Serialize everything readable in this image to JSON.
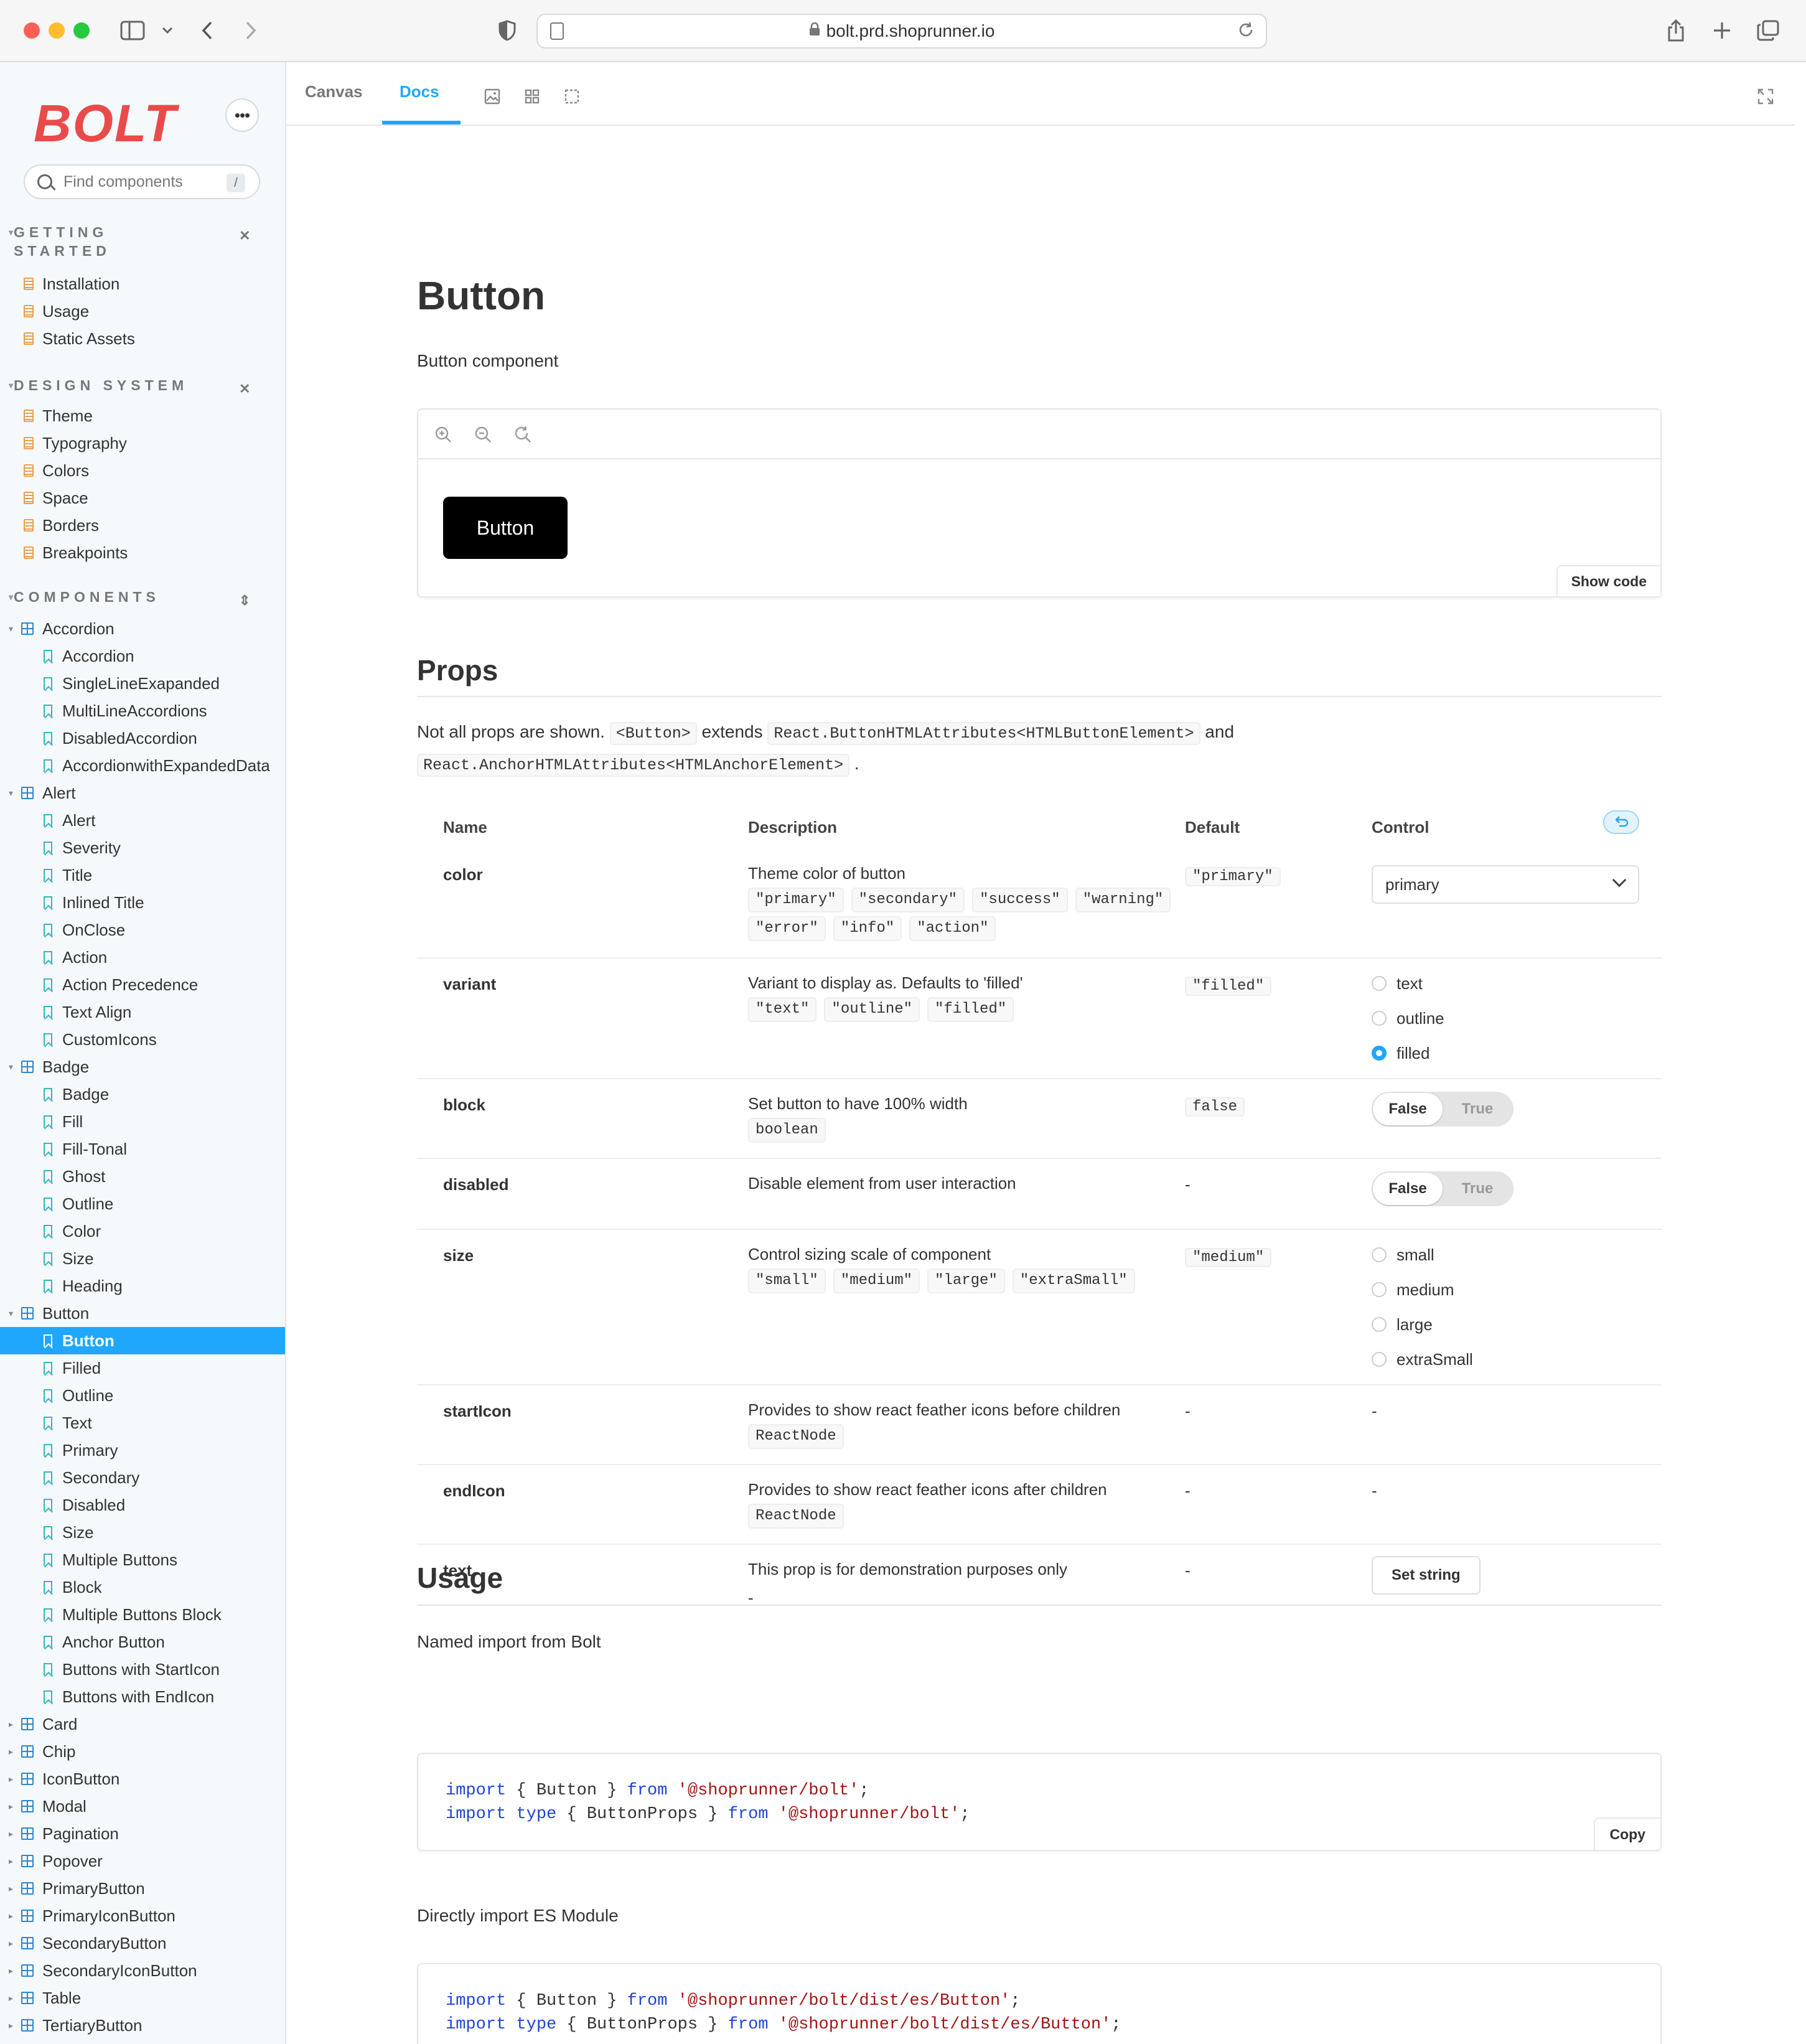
{
  "browser": {
    "url": "bolt.prd.shoprunner.io",
    "traffic_colors": [
      "#ff5f57",
      "#febc2e",
      "#28c840"
    ]
  },
  "sidebar": {
    "logo": "BOLT",
    "search_placeholder": "Find components",
    "search_shortcut": "/",
    "sections": [
      {
        "title_line1": "GETTING",
        "title_line2": "STARTED",
        "items": [
          "Installation",
          "Usage",
          "Static Assets"
        ]
      },
      {
        "title_line1": "DESIGN SYSTEM",
        "items": [
          "Theme",
          "Typography",
          "Colors",
          "Space",
          "Borders",
          "Breakpoints"
        ]
      },
      {
        "title_line1": "COMPONENTS"
      }
    ],
    "tree": [
      {
        "label": "Accordion",
        "type": "component",
        "expanded": true
      },
      {
        "label": "Accordion",
        "type": "story"
      },
      {
        "label": "SingleLineExapanded",
        "type": "story"
      },
      {
        "label": "MultiLineAccordions",
        "type": "story"
      },
      {
        "label": "DisabledAccordion",
        "type": "story"
      },
      {
        "label": "AccordionwithExpandedData",
        "type": "story"
      },
      {
        "label": "Alert",
        "type": "component",
        "expanded": true
      },
      {
        "label": "Alert",
        "type": "story"
      },
      {
        "label": "Severity",
        "type": "story"
      },
      {
        "label": "Title",
        "type": "story"
      },
      {
        "label": "Inlined Title",
        "type": "story"
      },
      {
        "label": "OnClose",
        "type": "story"
      },
      {
        "label": "Action",
        "type": "story"
      },
      {
        "label": "Action Precedence",
        "type": "story"
      },
      {
        "label": "Text Align",
        "type": "story"
      },
      {
        "label": "CustomIcons",
        "type": "story"
      },
      {
        "label": "Badge",
        "type": "component",
        "expanded": true
      },
      {
        "label": "Badge",
        "type": "story"
      },
      {
        "label": "Fill",
        "type": "story"
      },
      {
        "label": "Fill-Tonal",
        "type": "story"
      },
      {
        "label": "Ghost",
        "type": "story"
      },
      {
        "label": "Outline",
        "type": "story"
      },
      {
        "label": "Color",
        "type": "story"
      },
      {
        "label": "Size",
        "type": "story"
      },
      {
        "label": "Heading",
        "type": "story"
      },
      {
        "label": "Button",
        "type": "component",
        "expanded": true
      },
      {
        "label": "Button",
        "type": "story",
        "active": true
      },
      {
        "label": "Filled",
        "type": "story"
      },
      {
        "label": "Outline",
        "type": "story"
      },
      {
        "label": "Text",
        "type": "story"
      },
      {
        "label": "Primary",
        "type": "story"
      },
      {
        "label": "Secondary",
        "type": "story"
      },
      {
        "label": "Disabled",
        "type": "story"
      },
      {
        "label": "Size",
        "type": "story"
      },
      {
        "label": "Multiple Buttons",
        "type": "story"
      },
      {
        "label": "Block",
        "type": "story"
      },
      {
        "label": "Multiple Buttons Block",
        "type": "story"
      },
      {
        "label": "Anchor Button",
        "type": "story"
      },
      {
        "label": "Buttons with StartIcon",
        "type": "story"
      },
      {
        "label": "Buttons with EndIcon",
        "type": "story"
      },
      {
        "label": "Card",
        "type": "component"
      },
      {
        "label": "Chip",
        "type": "component"
      },
      {
        "label": "IconButton",
        "type": "component"
      },
      {
        "label": "Modal",
        "type": "component"
      },
      {
        "label": "Pagination",
        "type": "component"
      },
      {
        "label": "Popover",
        "type": "component"
      },
      {
        "label": "PrimaryButton",
        "type": "component"
      },
      {
        "label": "PrimaryIconButton",
        "type": "component"
      },
      {
        "label": "SecondaryButton",
        "type": "component"
      },
      {
        "label": "SecondaryIconButton",
        "type": "component"
      },
      {
        "label": "Table",
        "type": "component"
      },
      {
        "label": "TertiaryButton",
        "type": "component"
      }
    ]
  },
  "tabs": {
    "canvas": "Canvas",
    "docs": "Docs",
    "active": "docs"
  },
  "doc": {
    "title": "Button",
    "subtitle": "Button component",
    "demo_button": "Button",
    "show_code": "Show code",
    "props_heading": "Props",
    "props_note": {
      "t1": "Not all props are shown.",
      "c1": "<Button>",
      "t2": "extends",
      "c2": "React.ButtonHTMLAttributes<HTMLButtonElement>",
      "t3": "and",
      "c3": "React.AnchorHTMLAttributes<HTMLAnchorElement>",
      "t4": "."
    },
    "table_headers": {
      "name": "Name",
      "description": "Description",
      "default": "Default",
      "control": "Control"
    },
    "props": [
      {
        "name": "color",
        "description": "Theme color of button",
        "values": [
          "\"primary\"",
          "\"secondary\"",
          "\"success\"",
          "\"warning\"",
          "\"error\"",
          "\"info\"",
          "\"action\""
        ],
        "default": "\"primary\"",
        "control": {
          "type": "select",
          "value": "primary"
        }
      },
      {
        "name": "variant",
        "description": "Variant to display as. Defaults to 'filled'",
        "values": [
          "\"text\"",
          "\"outline\"",
          "\"filled\""
        ],
        "default": "\"filled\"",
        "control": {
          "type": "radio",
          "options": [
            "text",
            "outline",
            "filled"
          ],
          "selected": "filled"
        }
      },
      {
        "name": "block",
        "description": "Set button to have 100% width",
        "values": [
          "boolean"
        ],
        "default": "false",
        "control": {
          "type": "boolean",
          "false_label": "False",
          "true_label": "True",
          "value": "False"
        }
      },
      {
        "name": "disabled",
        "description": "Disable element from user interaction",
        "values": [],
        "default": "-",
        "control": {
          "type": "boolean",
          "false_label": "False",
          "true_label": "True",
          "value": "False"
        }
      },
      {
        "name": "size",
        "description": "Control sizing scale of component",
        "values": [
          "\"small\"",
          "\"medium\"",
          "\"large\"",
          "\"extraSmall\""
        ],
        "default": "\"medium\"",
        "control": {
          "type": "radio",
          "options": [
            "small",
            "medium",
            "large",
            "extraSmall"
          ],
          "selected": ""
        }
      },
      {
        "name": "startIcon",
        "description": "Provides to show react feather icons before children",
        "values": [
          "ReactNode"
        ],
        "default": "-",
        "control": {
          "type": "none",
          "value": "-"
        }
      },
      {
        "name": "endIcon",
        "description": "Provides to show react feather icons after children",
        "values": [
          "ReactNode"
        ],
        "default": "-",
        "control": {
          "type": "none",
          "value": "-"
        }
      },
      {
        "name": "text",
        "description": "This prop is for demonstration purposes only",
        "values": [],
        "extra": "-",
        "default": "-",
        "control": {
          "type": "button",
          "value": "Set string"
        }
      }
    ],
    "usage_heading": "Usage",
    "usage_named": "Named import from Bolt",
    "code1": [
      {
        "kw1": "import",
        "mid1": " { Button } ",
        "kw2": "from",
        "str": " '@shoprunner/bolt'",
        "end": ";"
      },
      {
        "kw1": "import type",
        "mid1": " { ButtonProps } ",
        "kw2": "from",
        "str": " '@shoprunner/bolt'",
        "end": ";"
      }
    ],
    "copy_label": "Copy",
    "usage_direct": "Directly import ES Module",
    "code2": [
      {
        "kw1": "import",
        "mid1": " { Button } ",
        "kw2": "from",
        "str": " '@shoprunner/bolt/dist/es/Button'",
        "end": ";"
      },
      {
        "kw1": "import type",
        "mid1": " { ButtonProps } ",
        "kw2": "from",
        "str": " '@shoprunner/bolt/dist/es/Button'",
        "end": ";"
      }
    ]
  }
}
